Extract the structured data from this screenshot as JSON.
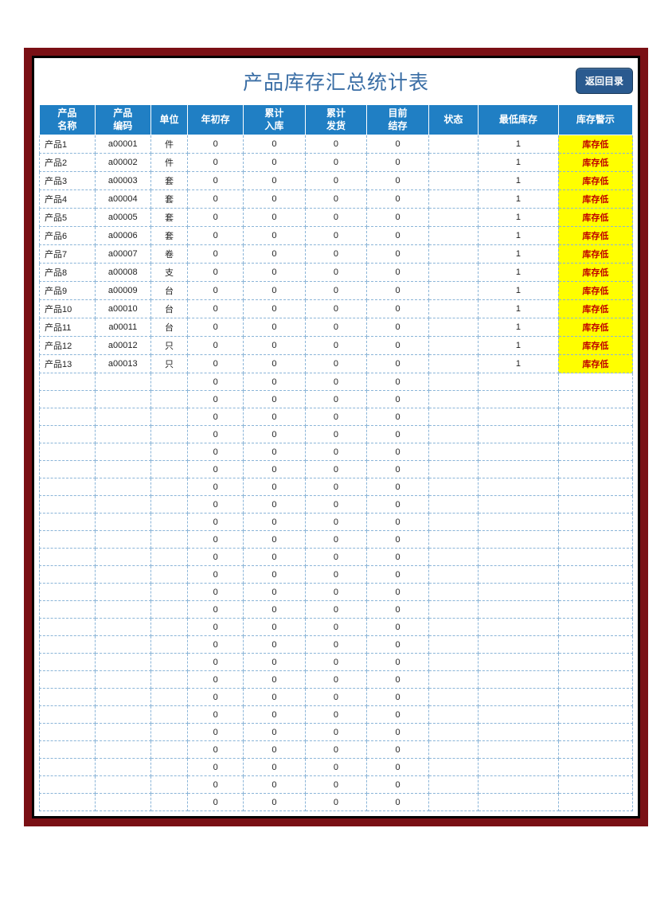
{
  "title": "产品库存汇总统计表",
  "back_button": "返回目录",
  "headers": {
    "name": "产品\n名称",
    "code": "产品\n编码",
    "unit": "单位",
    "begin": "年初存",
    "in": "累计\n入库",
    "out": "累计\n发货",
    "end": "目前\n结存",
    "status": "状态",
    "min": "最低库存",
    "alert": "库存警示"
  },
  "warning_label": "库存低",
  "rows": [
    {
      "name": "产品1",
      "code": "a00001",
      "unit": "件",
      "begin": 0,
      "in": 0,
      "out": 0,
      "end": 0,
      "status": "",
      "min": 1,
      "alert": true
    },
    {
      "name": "产品2",
      "code": "a00002",
      "unit": "件",
      "begin": 0,
      "in": 0,
      "out": 0,
      "end": 0,
      "status": "",
      "min": 1,
      "alert": true
    },
    {
      "name": "产品3",
      "code": "a00003",
      "unit": "套",
      "begin": 0,
      "in": 0,
      "out": 0,
      "end": 0,
      "status": "",
      "min": 1,
      "alert": true
    },
    {
      "name": "产品4",
      "code": "a00004",
      "unit": "套",
      "begin": 0,
      "in": 0,
      "out": 0,
      "end": 0,
      "status": "",
      "min": 1,
      "alert": true
    },
    {
      "name": "产品5",
      "code": "a00005",
      "unit": "套",
      "begin": 0,
      "in": 0,
      "out": 0,
      "end": 0,
      "status": "",
      "min": 1,
      "alert": true
    },
    {
      "name": "产品6",
      "code": "a00006",
      "unit": "套",
      "begin": 0,
      "in": 0,
      "out": 0,
      "end": 0,
      "status": "",
      "min": 1,
      "alert": true
    },
    {
      "name": "产品7",
      "code": "a00007",
      "unit": "卷",
      "begin": 0,
      "in": 0,
      "out": 0,
      "end": 0,
      "status": "",
      "min": 1,
      "alert": true
    },
    {
      "name": "产品8",
      "code": "a00008",
      "unit": "支",
      "begin": 0,
      "in": 0,
      "out": 0,
      "end": 0,
      "status": "",
      "min": 1,
      "alert": true
    },
    {
      "name": "产品9",
      "code": "a00009",
      "unit": "台",
      "begin": 0,
      "in": 0,
      "out": 0,
      "end": 0,
      "status": "",
      "min": 1,
      "alert": true
    },
    {
      "name": "产品10",
      "code": "a00010",
      "unit": "台",
      "begin": 0,
      "in": 0,
      "out": 0,
      "end": 0,
      "status": "",
      "min": 1,
      "alert": true
    },
    {
      "name": "产品11",
      "code": "a00011",
      "unit": "台",
      "begin": 0,
      "in": 0,
      "out": 0,
      "end": 0,
      "status": "",
      "min": 1,
      "alert": true
    },
    {
      "name": "产品12",
      "code": "a00012",
      "unit": "只",
      "begin": 0,
      "in": 0,
      "out": 0,
      "end": 0,
      "status": "",
      "min": 1,
      "alert": true
    },
    {
      "name": "产品13",
      "code": "a00013",
      "unit": "只",
      "begin": 0,
      "in": 0,
      "out": 0,
      "end": 0,
      "status": "",
      "min": 1,
      "alert": true
    },
    {
      "name": "",
      "code": "",
      "unit": "",
      "begin": 0,
      "in": 0,
      "out": 0,
      "end": 0,
      "status": "",
      "min": "",
      "alert": false
    },
    {
      "name": "",
      "code": "",
      "unit": "",
      "begin": 0,
      "in": 0,
      "out": 0,
      "end": 0,
      "status": "",
      "min": "",
      "alert": false
    },
    {
      "name": "",
      "code": "",
      "unit": "",
      "begin": 0,
      "in": 0,
      "out": 0,
      "end": 0,
      "status": "",
      "min": "",
      "alert": false
    },
    {
      "name": "",
      "code": "",
      "unit": "",
      "begin": 0,
      "in": 0,
      "out": 0,
      "end": 0,
      "status": "",
      "min": "",
      "alert": false
    },
    {
      "name": "",
      "code": "",
      "unit": "",
      "begin": 0,
      "in": 0,
      "out": 0,
      "end": 0,
      "status": "",
      "min": "",
      "alert": false
    },
    {
      "name": "",
      "code": "",
      "unit": "",
      "begin": 0,
      "in": 0,
      "out": 0,
      "end": 0,
      "status": "",
      "min": "",
      "alert": false
    },
    {
      "name": "",
      "code": "",
      "unit": "",
      "begin": 0,
      "in": 0,
      "out": 0,
      "end": 0,
      "status": "",
      "min": "",
      "alert": false
    },
    {
      "name": "",
      "code": "",
      "unit": "",
      "begin": 0,
      "in": 0,
      "out": 0,
      "end": 0,
      "status": "",
      "min": "",
      "alert": false
    },
    {
      "name": "",
      "code": "",
      "unit": "",
      "begin": 0,
      "in": 0,
      "out": 0,
      "end": 0,
      "status": "",
      "min": "",
      "alert": false
    },
    {
      "name": "",
      "code": "",
      "unit": "",
      "begin": 0,
      "in": 0,
      "out": 0,
      "end": 0,
      "status": "",
      "min": "",
      "alert": false
    },
    {
      "name": "",
      "code": "",
      "unit": "",
      "begin": 0,
      "in": 0,
      "out": 0,
      "end": 0,
      "status": "",
      "min": "",
      "alert": false
    },
    {
      "name": "",
      "code": "",
      "unit": "",
      "begin": 0,
      "in": 0,
      "out": 0,
      "end": 0,
      "status": "",
      "min": "",
      "alert": false
    },
    {
      "name": "",
      "code": "",
      "unit": "",
      "begin": 0,
      "in": 0,
      "out": 0,
      "end": 0,
      "status": "",
      "min": "",
      "alert": false
    },
    {
      "name": "",
      "code": "",
      "unit": "",
      "begin": 0,
      "in": 0,
      "out": 0,
      "end": 0,
      "status": "",
      "min": "",
      "alert": false
    },
    {
      "name": "",
      "code": "",
      "unit": "",
      "begin": 0,
      "in": 0,
      "out": 0,
      "end": 0,
      "status": "",
      "min": "",
      "alert": false
    },
    {
      "name": "",
      "code": "",
      "unit": "",
      "begin": 0,
      "in": 0,
      "out": 0,
      "end": 0,
      "status": "",
      "min": "",
      "alert": false
    },
    {
      "name": "",
      "code": "",
      "unit": "",
      "begin": 0,
      "in": 0,
      "out": 0,
      "end": 0,
      "status": "",
      "min": "",
      "alert": false
    },
    {
      "name": "",
      "code": "",
      "unit": "",
      "begin": 0,
      "in": 0,
      "out": 0,
      "end": 0,
      "status": "",
      "min": "",
      "alert": false
    },
    {
      "name": "",
      "code": "",
      "unit": "",
      "begin": 0,
      "in": 0,
      "out": 0,
      "end": 0,
      "status": "",
      "min": "",
      "alert": false
    },
    {
      "name": "",
      "code": "",
      "unit": "",
      "begin": 0,
      "in": 0,
      "out": 0,
      "end": 0,
      "status": "",
      "min": "",
      "alert": false
    },
    {
      "name": "",
      "code": "",
      "unit": "",
      "begin": 0,
      "in": 0,
      "out": 0,
      "end": 0,
      "status": "",
      "min": "",
      "alert": false
    },
    {
      "name": "",
      "code": "",
      "unit": "",
      "begin": 0,
      "in": 0,
      "out": 0,
      "end": 0,
      "status": "",
      "min": "",
      "alert": false
    },
    {
      "name": "",
      "code": "",
      "unit": "",
      "begin": 0,
      "in": 0,
      "out": 0,
      "end": 0,
      "status": "",
      "min": "",
      "alert": false
    },
    {
      "name": "",
      "code": "",
      "unit": "",
      "begin": 0,
      "in": 0,
      "out": 0,
      "end": 0,
      "status": "",
      "min": "",
      "alert": false
    },
    {
      "name": "",
      "code": "",
      "unit": "",
      "begin": 0,
      "in": 0,
      "out": 0,
      "end": 0,
      "status": "",
      "min": "",
      "alert": false
    }
  ]
}
